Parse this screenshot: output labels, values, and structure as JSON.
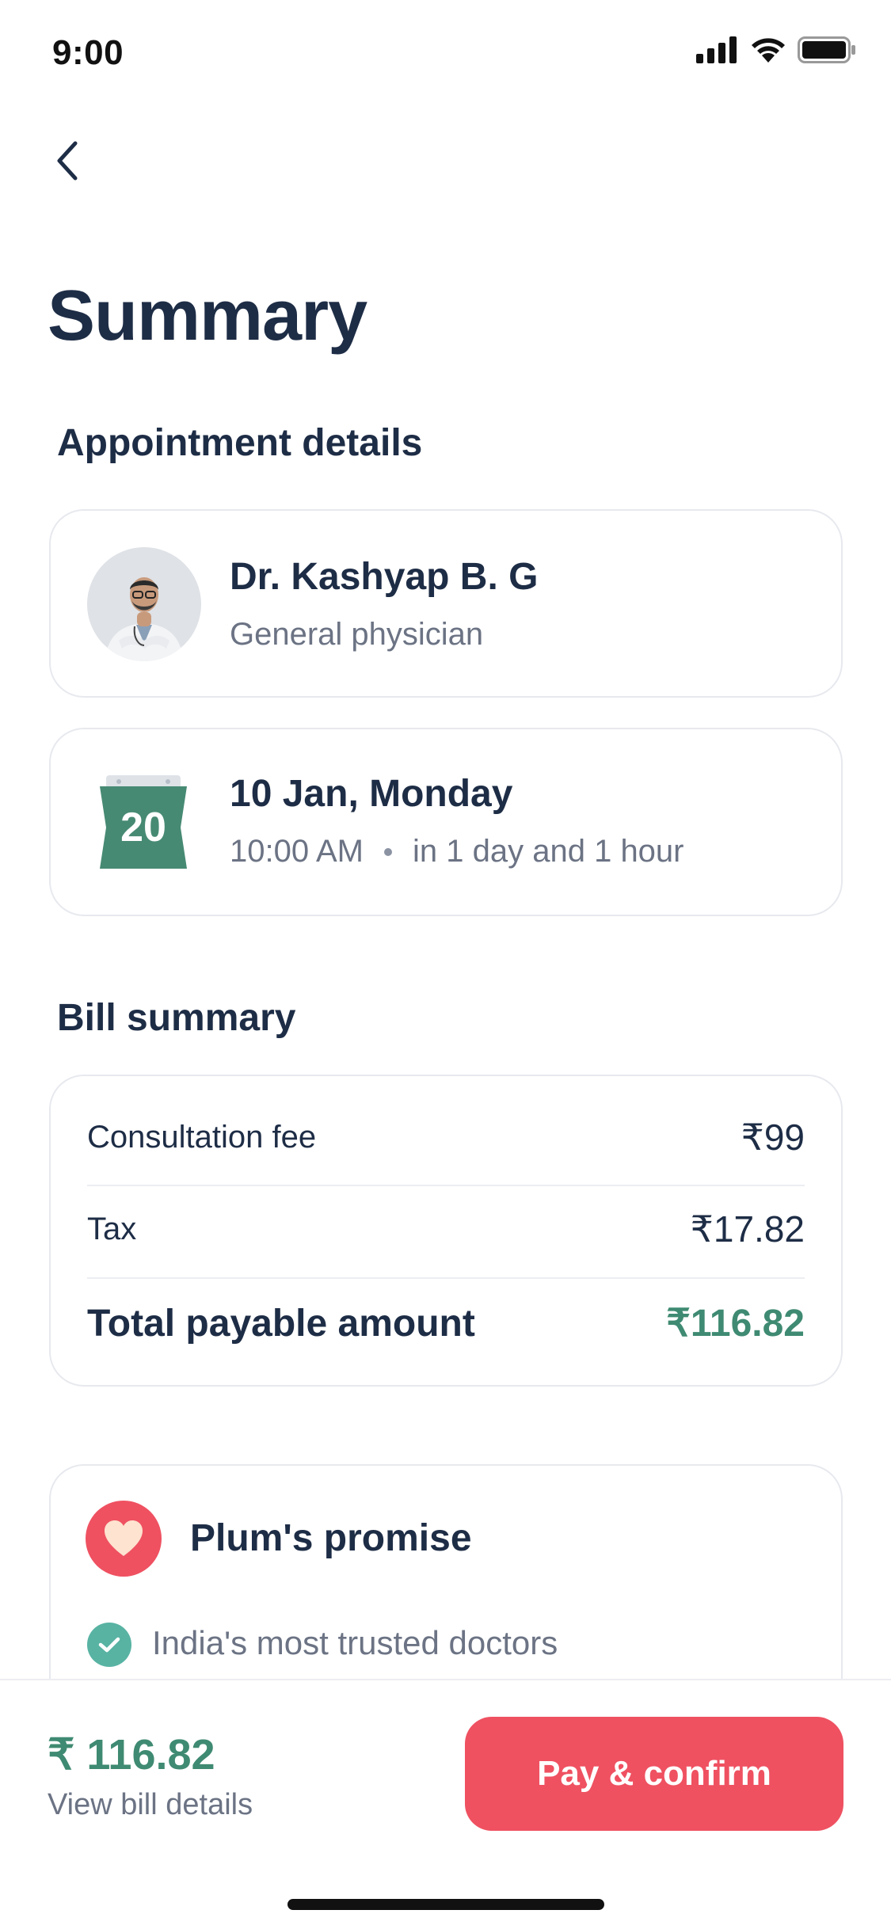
{
  "status_bar": {
    "time": "9:00"
  },
  "header": {
    "title": "Summary"
  },
  "appointment": {
    "section_title": "Appointment details",
    "doctor_name": "Dr. Kashyap B. G",
    "doctor_specialty": "General physician",
    "calendar_day": "20",
    "date_label": "10 Jan, Monday",
    "time": "10:00 AM",
    "relative_time": "in 1 day and 1 hour"
  },
  "bill": {
    "section_title": "Bill summary",
    "rows": [
      {
        "label": "Consultation fee",
        "value": "₹99"
      },
      {
        "label": "Tax",
        "value": "₹17.82"
      }
    ],
    "total_label": "Total payable amount",
    "total_value": "₹116.82"
  },
  "promise": {
    "title": "Plum's promise",
    "items": [
      "India's most trusted doctors"
    ]
  },
  "footer": {
    "amount": "₹ 116.82",
    "bill_link": "View bill details",
    "pay_button": "Pay & confirm"
  },
  "colors": {
    "accent_red": "#ef5161",
    "accent_green": "#3f8a72",
    "text_dark": "#1e2d46",
    "text_muted": "#6b7384"
  }
}
